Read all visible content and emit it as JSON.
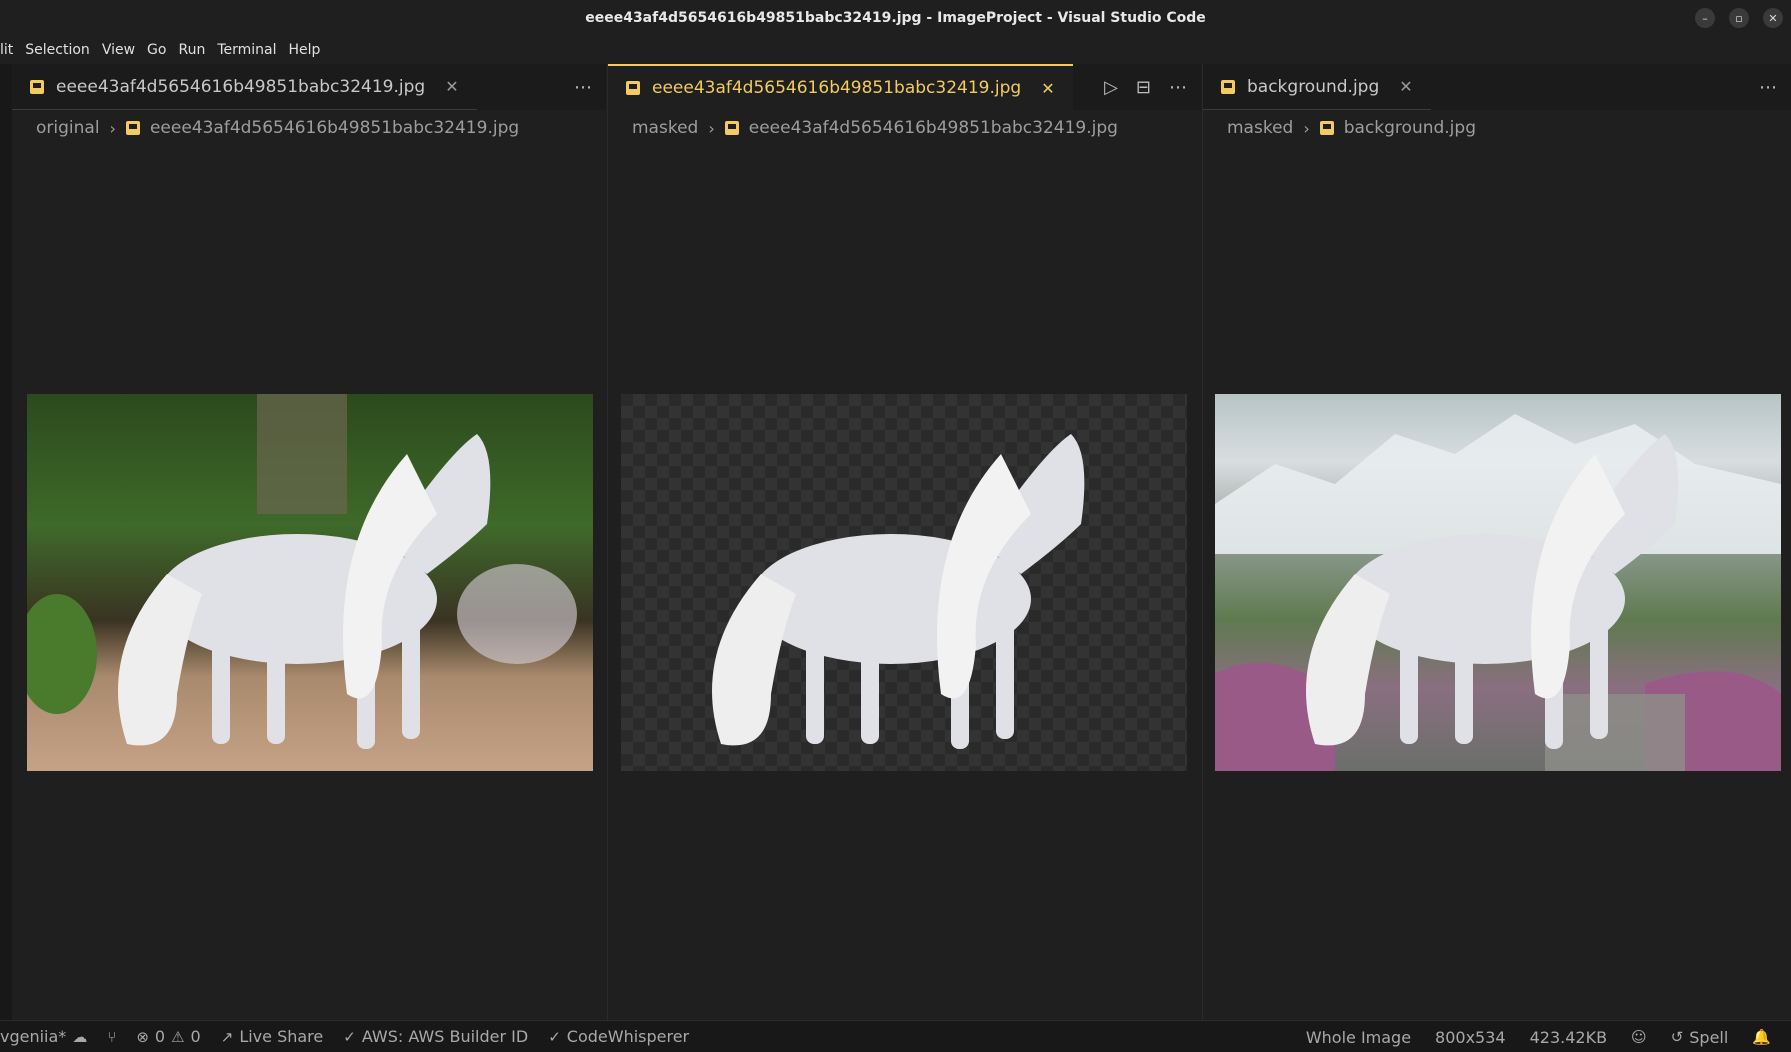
{
  "window": {
    "title": "eeee43af4d5654616b49851babc32419.jpg - ImageProject - Visual Studio Code",
    "controls": [
      "–",
      "▫",
      "✕"
    ]
  },
  "menu": [
    "lit",
    "Selection",
    "View",
    "Go",
    "Run",
    "Terminal",
    "Help"
  ],
  "groups": [
    {
      "tab": {
        "label": "eeee43af4d5654616b49851babc32419.jpg",
        "active": false
      },
      "breadcrumb": {
        "folder": "original",
        "file": "eeee43af4d5654616b49851babc32419.jpg"
      },
      "image": {
        "kind": "original"
      }
    },
    {
      "tab": {
        "label": "eeee43af4d5654616b49851babc32419.jpg",
        "active": true
      },
      "breadcrumb": {
        "folder": "masked",
        "file": "eeee43af4d5654616b49851babc32419.jpg"
      },
      "image": {
        "kind": "masked"
      }
    },
    {
      "tab": {
        "label": "background.jpg",
        "active": false
      },
      "breadcrumb": {
        "folder": "masked",
        "file": "background.jpg"
      },
      "image": {
        "kind": "background"
      }
    }
  ],
  "statusbar": {
    "left": {
      "branch": "vgeniia*",
      "errors": "0",
      "warnings": "0",
      "live_share": "Live Share",
      "aws": "AWS: AWS Builder ID",
      "codewhisperer": "CodeWhisperer"
    },
    "right": {
      "zoom": "Whole Image",
      "dimensions": "800x534",
      "size": "423.42KB",
      "spell": "Spell"
    }
  },
  "colors": {
    "accent": "#f2cc60",
    "background": "#1f1f1f",
    "statusbar": "#181818"
  }
}
